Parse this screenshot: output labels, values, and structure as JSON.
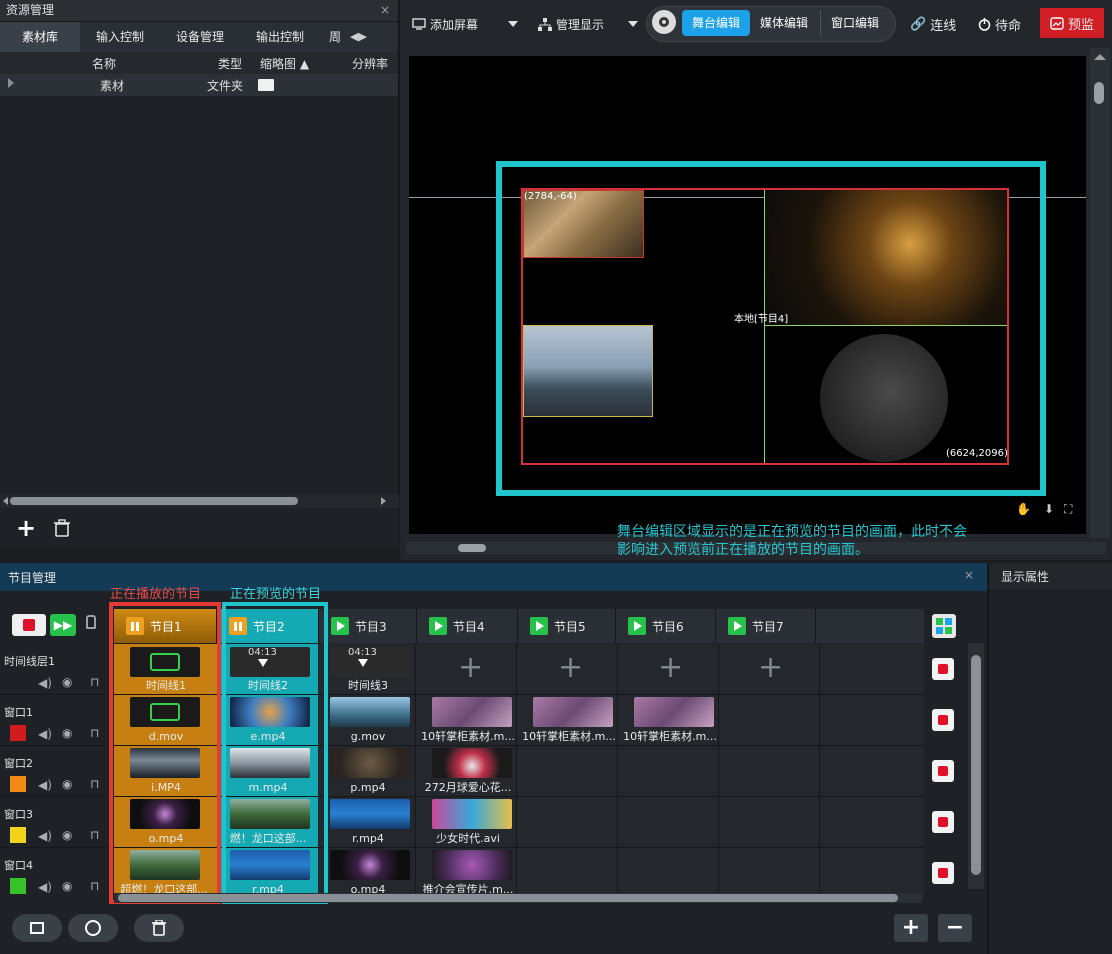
{
  "resource": {
    "title": "资源管理",
    "close": "×",
    "tabs": [
      "素材库",
      "输入控制",
      "设备管理",
      "输出控制",
      "周"
    ],
    "columns": [
      "名称",
      "类型",
      "缩略图 ▲",
      "分辨率"
    ],
    "rows": [
      {
        "name": "素材",
        "type": "文件夹"
      }
    ],
    "add": "+",
    "delete": "🗑"
  },
  "toolbar": {
    "add_screen": "添加屏幕",
    "manage_display": "管理显示",
    "seg_stage": "舞台编辑",
    "seg_media": "媒体编辑",
    "seg_window": "窗口编辑",
    "connect": "连线",
    "standby": "待命",
    "preview": "预监"
  },
  "stage": {
    "coord_top": "(2784,-64)",
    "coord_bottom": "(6624,2096)",
    "local_label": "本地[节目4]",
    "annotation_line1": "舞台编辑区域显示的是正在预览的节目的画面，此时不会",
    "annotation_line2": "影响进入预览前正在播放的节目的画面。"
  },
  "program": {
    "title": "节目管理",
    "close": "×",
    "label_playing": "正在播放的节目",
    "label_previewing": "正在预览的节目",
    "tabs": [
      "节目1",
      "节目2",
      "节目3",
      "节目4",
      "节目5",
      "节目6",
      "节目7"
    ],
    "rows": [
      "时间线层1",
      "窗口1",
      "窗口2",
      "窗口3",
      "窗口4"
    ],
    "timeline_time": "04:13",
    "cells": {
      "r0": [
        "时间线1",
        "时间线2",
        "时间线3"
      ],
      "r1": [
        "d.mov",
        "e.mp4",
        "g.mov",
        "10轩掌柜素材.m...",
        "10轩掌柜素材.m...",
        "10轩掌柜素材.m..."
      ],
      "r2": [
        "i.MP4",
        "m.mp4",
        "p.mp4",
        "272月球爱心花..."
      ],
      "r3": [
        "o.mp4",
        "燃！龙口这部...",
        "r.mp4",
        "少女时代.avi"
      ],
      "r4": [
        "超燃！龙口这部...",
        "r.mp4",
        "o.mp4",
        "推介会宣传片.m..."
      ]
    },
    "add": "+",
    "remove": "−"
  },
  "display_props": {
    "title": "显示属性"
  },
  "colors": {
    "accent_cyan": "#20c4cc",
    "accent_red": "#e53935",
    "play_green": "#27c24c",
    "orange": "#e0900f"
  }
}
